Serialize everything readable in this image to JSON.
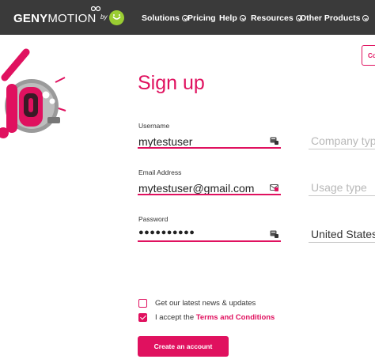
{
  "header": {
    "logo_bold": "GENY",
    "logo_light": "MOTION",
    "logo_by": "by",
    "nav": [
      {
        "label": "Solutions",
        "has_dropdown": true
      },
      {
        "label": "Pricing",
        "has_dropdown": false
      },
      {
        "label": "Help",
        "has_dropdown": true
      },
      {
        "label": "Resources",
        "has_dropdown": true
      },
      {
        "label": "Other Products",
        "has_dropdown": true
      }
    ]
  },
  "top_right_button": "Co",
  "form": {
    "title": "Sign up",
    "username": {
      "label": "Username",
      "value": "mytestuser"
    },
    "email": {
      "label": "Email Address",
      "value": "mytestuser@gmail.com"
    },
    "password": {
      "label": "Password",
      "value": "●●●●●●●●●●"
    },
    "company_type_placeholder": "Company type",
    "usage_type_placeholder": "Usage type",
    "country_value": "United States",
    "newsletter": {
      "label": "Get our latest news & updates",
      "checked": false
    },
    "terms": {
      "prefix": "I accept the ",
      "link": "Terms and Conditions",
      "checked": true
    },
    "submit": "Create an account"
  },
  "colors": {
    "accent": "#e0115f",
    "header_bg": "#3a3a3a",
    "placeholder": "#b8b8b8"
  }
}
